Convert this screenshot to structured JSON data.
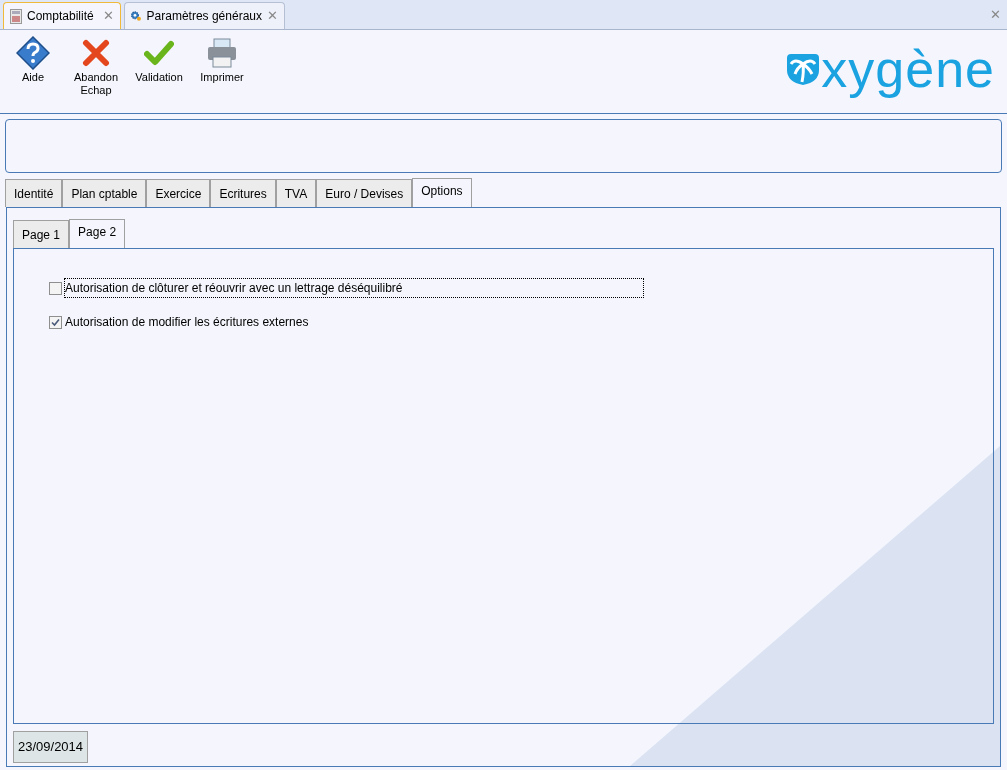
{
  "doc_tabs": [
    {
      "label": "Comptabilité",
      "kind": "calculator",
      "selected": true,
      "close": "✕"
    },
    {
      "label": "Paramètres généraux",
      "kind": "gears",
      "selected": false,
      "close": "✕"
    }
  ],
  "window_close": "✕",
  "toolbar": [
    {
      "label": "Aide",
      "kind": "help"
    },
    {
      "label": "Abandon\nEchap",
      "kind": "cancel"
    },
    {
      "label": "Validation",
      "kind": "check"
    },
    {
      "label": "Imprimer",
      "kind": "printer"
    }
  ],
  "logo": "xygène",
  "tabs": [
    {
      "label": "Identité",
      "selected": false
    },
    {
      "label": "Plan cptable",
      "selected": false
    },
    {
      "label": "Exercice",
      "selected": false
    },
    {
      "label": "Ecritures",
      "selected": false
    },
    {
      "label": "TVA",
      "selected": false
    },
    {
      "label": "Euro / Devises",
      "selected": false
    },
    {
      "label": "Options",
      "selected": true
    }
  ],
  "subtabs": [
    {
      "label": "Page 1",
      "selected": false
    },
    {
      "label": "Page 2",
      "selected": true
    }
  ],
  "options": [
    {
      "label": "Autorisation de clôturer et réouvrir avec un lettrage déséquilibré",
      "checked": false,
      "focused": true
    },
    {
      "label": "Autorisation de modifier les écritures externes",
      "checked": true,
      "focused": false
    }
  ],
  "date": "23/09/2014"
}
